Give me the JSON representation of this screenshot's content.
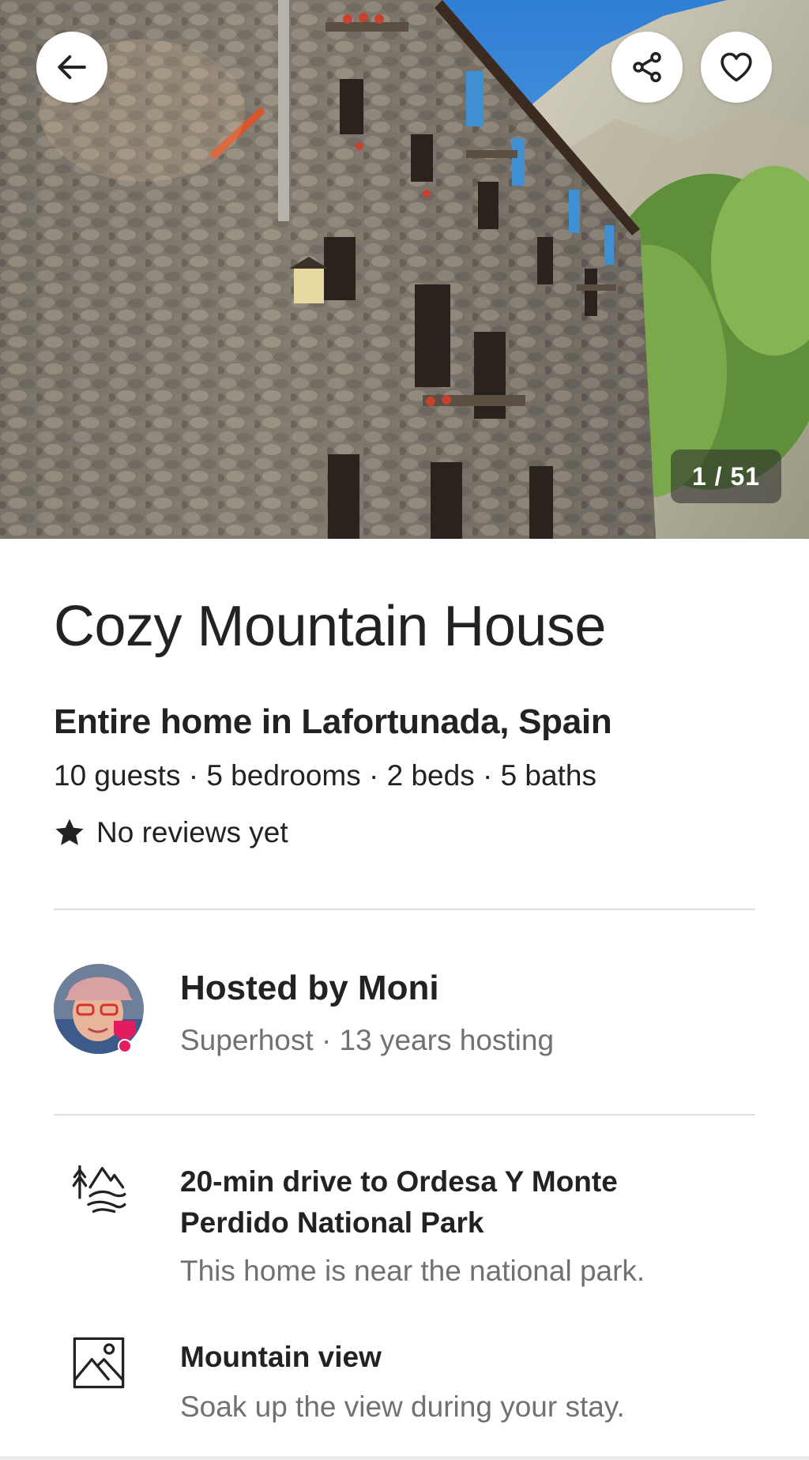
{
  "photo": {
    "counter": "1 / 51"
  },
  "icons": {
    "back": "arrow-left-icon",
    "share": "share-icon",
    "favorite": "heart-icon",
    "rating": "star-icon",
    "feature_1": "national-park-icon",
    "feature_2": "mountain-view-icon"
  },
  "listing": {
    "title": "Cozy Mountain House",
    "subtitle": "Entire home in Lafortunada, Spain",
    "details": "10 guests · 5 bedrooms · 2 beds · 5 baths",
    "reviews": "No reviews yet"
  },
  "host": {
    "name": "Hosted by Moni",
    "meta": "Superhost · 13 years hosting"
  },
  "features": [
    {
      "title": "20-min drive to Ordesa Y Monte Perdido National Park",
      "description": "This home is near the national park."
    },
    {
      "title": "Mountain view",
      "description": "Soak up the view during your stay."
    }
  ],
  "colors": {
    "text": "#222222",
    "secondary_text": "#717171",
    "divider": "#dddddd",
    "superhost_badge": "#e31c5f"
  }
}
